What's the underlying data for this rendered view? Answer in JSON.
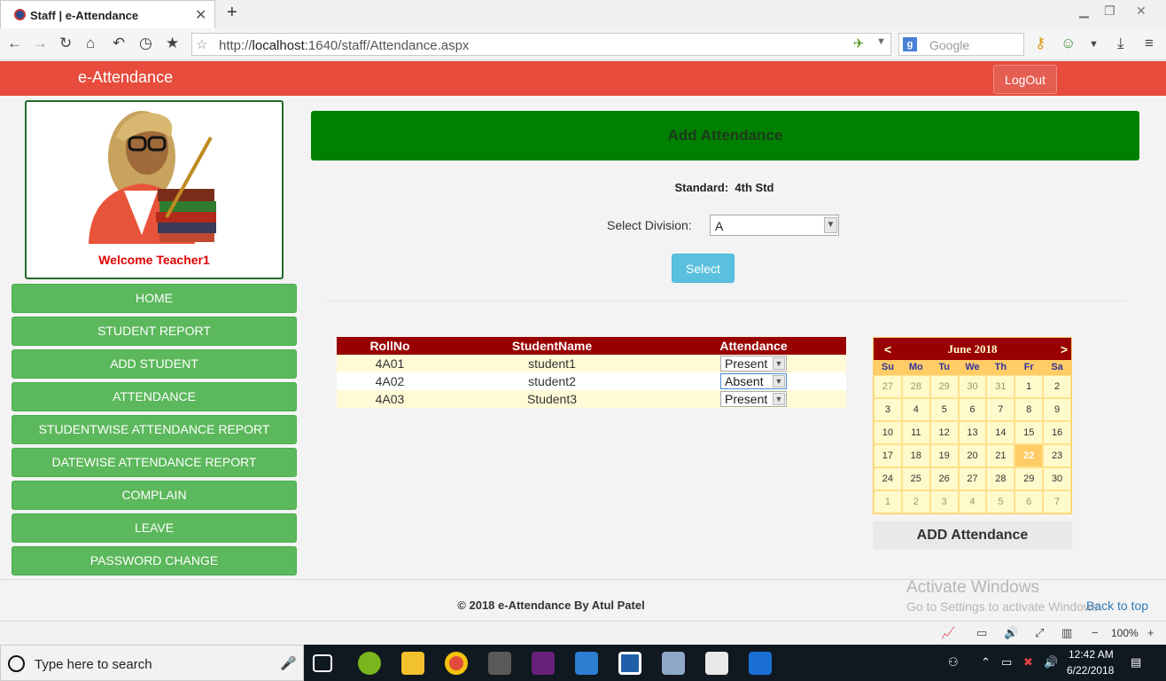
{
  "browser": {
    "tab_title": "Staff | e-Attendance",
    "url_prefix": "http://",
    "url_host": "localhost",
    "url_rest": ":1640/staff/Attendance.aspx",
    "search_placeholder": "Google"
  },
  "app": {
    "brand": "e-Attendance",
    "logout_label": "LogOut",
    "welcome": "Welcome Teacher1"
  },
  "menu": [
    "HOME",
    "STUDENT REPORT",
    "ADD STUDENT",
    "ATTENDANCE",
    "STUDENTWISE ATTENDANCE REPORT",
    "DATEWISE ATTENDANCE REPORT",
    "COMPLAIN",
    "LEAVE",
    "PASSWORD CHANGE"
  ],
  "main": {
    "panel_title": "Add Attendance",
    "standard_label": "Standard:",
    "standard_value": "4th Std",
    "division_label": "Select Division:",
    "division_value": "A",
    "select_button": "Select"
  },
  "grid": {
    "headers": [
      "RollNo",
      "StudentName",
      "Attendance"
    ],
    "rows": [
      {
        "roll": "4A01",
        "name": "student1",
        "attendance": "Present"
      },
      {
        "roll": "4A02",
        "name": "student2",
        "attendance": "Absent"
      },
      {
        "roll": "4A03",
        "name": "Student3",
        "attendance": "Present"
      }
    ]
  },
  "calendar": {
    "prev": "<",
    "next": ">",
    "title": "June 2018",
    "dows": [
      "Su",
      "Mo",
      "Tu",
      "We",
      "Th",
      "Fr",
      "Sa"
    ],
    "days": [
      "27",
      "28",
      "29",
      "30",
      "31",
      "1",
      "2",
      "3",
      "4",
      "5",
      "6",
      "7",
      "8",
      "9",
      "10",
      "11",
      "12",
      "13",
      "14",
      "15",
      "16",
      "17",
      "18",
      "19",
      "20",
      "21",
      "22",
      "23",
      "24",
      "25",
      "26",
      "27",
      "28",
      "29",
      "30",
      "1",
      "2",
      "3",
      "4",
      "5",
      "6",
      "7"
    ],
    "other_month_indices": [
      0,
      1,
      2,
      3,
      4,
      35,
      36,
      37,
      38,
      39,
      40,
      41
    ],
    "selected_index": 26,
    "caption": "ADD Attendance"
  },
  "footer": {
    "copyright": "© 2018 e-Attendance By Atul Patel",
    "back_to_top": "Back to top",
    "activate_title": "Activate Windows",
    "activate_sub": "Go to Settings to activate Windows."
  },
  "statusbar": {
    "zoom": "100%"
  },
  "taskbar": {
    "search_placeholder": "Type here to search",
    "time": "12:42 AM",
    "date": "6/22/2018"
  },
  "colors": {
    "header": "#e74c3c",
    "menu_green": "#5cb85c",
    "panel_green": "#008000",
    "grid_header": "#990000",
    "calendar_header": "#990000",
    "calendar_selected": "#ffcc66"
  }
}
